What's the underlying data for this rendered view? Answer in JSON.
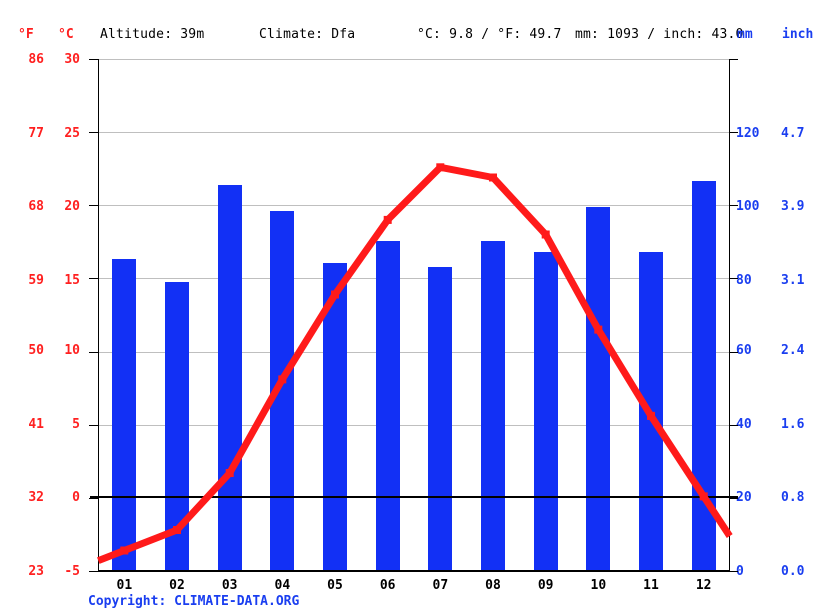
{
  "header": {
    "left_unit_f": "°F",
    "left_unit_c": "°C",
    "altitude": "Altitude: 39m",
    "climate": "Climate: Dfa",
    "avg_temp": "°C: 9.8 / °F: 49.7",
    "avg_precip": "mm: 1093 / inch: 43.0",
    "right_unit_mm": "mm",
    "right_unit_inch": "inch"
  },
  "footer": {
    "copyright": "Copyright: CLIMATE-DATA.ORG"
  },
  "colors": {
    "temperature_line": "#ff1a1a",
    "precipitation_bar": "#1230f5",
    "left_axis_text": "#ff2020",
    "right_axis_text": "#1a3ef0",
    "gridline": "#bfbfbf",
    "zero_line": "#000000"
  },
  "axes": {
    "left_c_ticks": [
      "30",
      "25",
      "20",
      "15",
      "10",
      "5",
      "0",
      "-5"
    ],
    "left_f_ticks": [
      "86",
      "77",
      "68",
      "59",
      "50",
      "41",
      "32",
      "23"
    ],
    "right_mm_ticks": [
      "",
      "120",
      "100",
      "80",
      "60",
      "40",
      "20",
      "0"
    ],
    "right_inch_ticks": [
      "",
      "4.7",
      "3.9",
      "3.1",
      "2.4",
      "1.6",
      "0.8",
      "0.0"
    ]
  },
  "chart_data": {
    "type": "bar",
    "title": "",
    "xlabel": "",
    "ylabel": "",
    "grid": true,
    "legend": "none",
    "categories": [
      "01",
      "02",
      "03",
      "04",
      "05",
      "06",
      "07",
      "08",
      "09",
      "10",
      "11",
      "12"
    ],
    "series": [
      {
        "name": "Precipitation",
        "type": "bar",
        "unit": "mm",
        "axis": "right",
        "values": [
          84,
          78,
          104,
          97,
          83,
          89,
          82,
          89,
          86,
          98,
          86,
          105
        ],
        "ylim": [
          0,
          138
        ]
      },
      {
        "name": "Temperature",
        "type": "line",
        "unit": "°C",
        "axis": "left",
        "values": [
          -3.6,
          -2.2,
          1.7,
          8.1,
          13.9,
          19.0,
          22.6,
          21.9,
          18.0,
          11.5,
          5.6,
          0.1
        ],
        "ylim": [
          -5,
          30
        ]
      }
    ]
  }
}
